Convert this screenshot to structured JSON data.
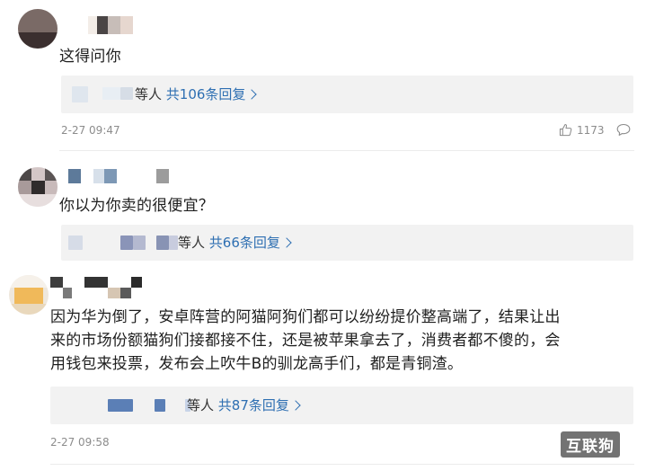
{
  "colors": {
    "text": "#1f1f1f",
    "link": "#2e6fb2",
    "muted": "#8c8c8c",
    "reply_bg": "#f2f2f2"
  },
  "comments": [
    {
      "text": "这得问你",
      "reply_people": "等人",
      "reply_link": "共106条回复",
      "time": "2-27 09:47",
      "likes": "1173"
    },
    {
      "text": "你以为你卖的很便宜？",
      "reply_people": "等人",
      "reply_link": "共66条回复"
    },
    {
      "text_lines": [
        "因为华为倒了，安卓阵营的阿猫阿狗们都可以纷纷提价整高端了，结果让出",
        "来的市场份额猫狗们接都接不住，还是被苹果拿去了，消费者都不傻的，会",
        "用钱包来投票，发布会上吹牛B的驯龙高手们，都是青铜渣。"
      ],
      "reply_people": "等人",
      "reply_link": "共87条回复",
      "time": "2-27 09:58"
    }
  ],
  "watermark": "互联狗"
}
